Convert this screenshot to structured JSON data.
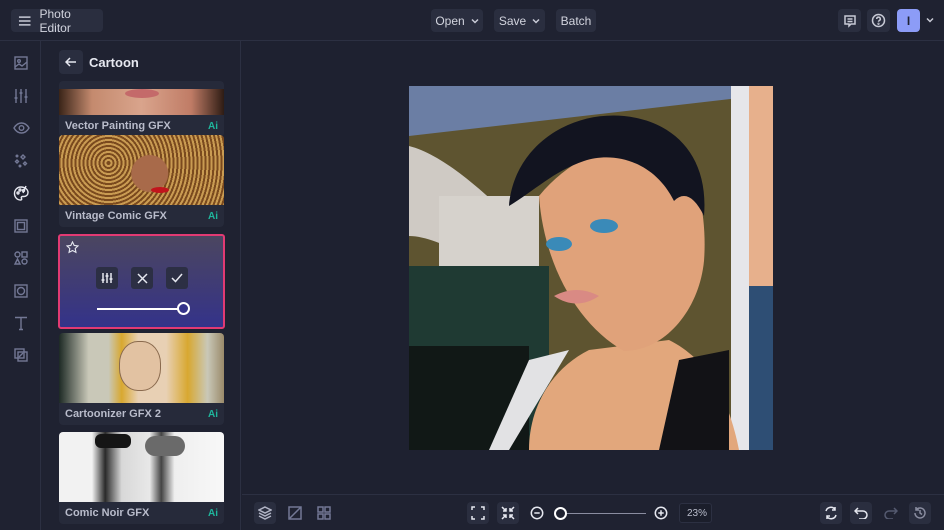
{
  "app": {
    "title": "Photo Editor",
    "menu_icon": "hamburger-menu-icon"
  },
  "topbar": {
    "open_label": "Open",
    "save_label": "Save",
    "batch_label": "Batch",
    "avatar_initial": "I",
    "accent_color": "#8c9cf7"
  },
  "rail": {
    "items": [
      "image-icon",
      "adjust-sliders-icon",
      "eye-icon",
      "sparkle-effects-icon",
      "palette-icon",
      "frame-icon",
      "shapes-icon",
      "texture-icon",
      "text-icon",
      "overlay-icon"
    ],
    "active": "palette-icon"
  },
  "panel": {
    "title": "Cartoon",
    "ai_badge": "Ai",
    "cards": [
      {
        "label": "Vector Painting GFX",
        "ai": true
      },
      {
        "label": "Vintage Comic GFX",
        "ai": true
      },
      {
        "label": "Cartoonizer GFX 2",
        "ai": true
      },
      {
        "label": "Comic Noir GFX",
        "ai": true
      }
    ],
    "selected": {
      "favorite_icon": "star-outline-icon",
      "settings": "settings",
      "cancel": "cancel",
      "apply": "apply",
      "intensity": 1.0,
      "highlight_color": "#e23a73"
    }
  },
  "bottombar": {
    "zoom_value": "23%",
    "zoom_fraction": 0.0
  }
}
